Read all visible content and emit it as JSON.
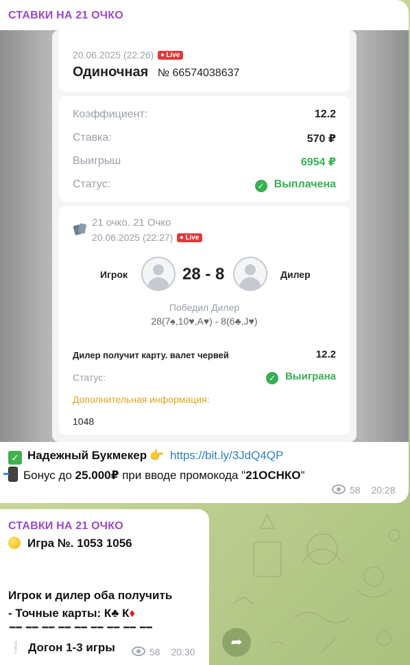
{
  "message1": {
    "channel": "СТАВКИ НА 21 ОЧКО",
    "receipt": {
      "header": {
        "datetime": "20.06.2025 (22:26)",
        "live_badge": "Live",
        "bet_type": "Одиночная",
        "bet_number": "№ 66574038637"
      },
      "summary": {
        "odds_label": "Коэффициент:",
        "odds_value": "12.2",
        "stake_label": "Ставка:",
        "stake_value": "570 ₽",
        "win_label": "Выигрыш",
        "win_value": "6954 ₽",
        "status_label": "Статус:",
        "status_value": "Выплачена"
      },
      "event": {
        "title": "21 очко. 21 Очко",
        "datetime": "20.06.2025 (22:27)",
        "live_badge": "Live",
        "player_label": "Игрок",
        "score": "28 - 8",
        "dealer_label": "Дилер",
        "winner_text": "Победил Дилер",
        "cards_text": "28(7♠,10♥,A♥) - 8(6♣,J♥)",
        "outcome_label": "Дилер получит карту. валет червей",
        "outcome_odds": "12.2",
        "status_label": "Статус:",
        "status_value": "Выиграна",
        "extra_info_label": "Дополнительная информация:",
        "extra_info_value": "1048"
      }
    },
    "caption_line1_text": "Надежный Букмекер",
    "caption_link": "https://bit.ly/3JdQ4QP",
    "caption_line2_prefix": "Бонус до ",
    "caption_line2_bold": "25.000₽",
    "caption_line2_mid": " при вводе промокода \"",
    "caption_line2_code": "21ОСНКО",
    "caption_line2_end": "\"",
    "views": "58",
    "time": "20:28"
  },
  "message2": {
    "channel": "СТАВКИ НА 21 ОЧКО",
    "game_line": "Игра №. 1053   1056",
    "players_line": "Игрок и дилер оба получить",
    "cards_prefix": "- Точные карты:  К",
    "cards_mid": "  К",
    "dashes": "━━ ━━ ━━ ━━ ━━ ━━ ━━ ━━ ━━",
    "catchup": "Догон 1-3 игры",
    "views": "58",
    "time": "20:30"
  },
  "icons": {
    "views": "eye-icon",
    "share": "share-arrow-icon",
    "check": "checkmark-icon",
    "cards": "cards-icon"
  },
  "colors": {
    "channel_name": "#9b49c6",
    "link": "#2e7fc4",
    "success_green": "#35b052",
    "live_red": "#e03a3a",
    "info_gold": "#e0a41c"
  }
}
